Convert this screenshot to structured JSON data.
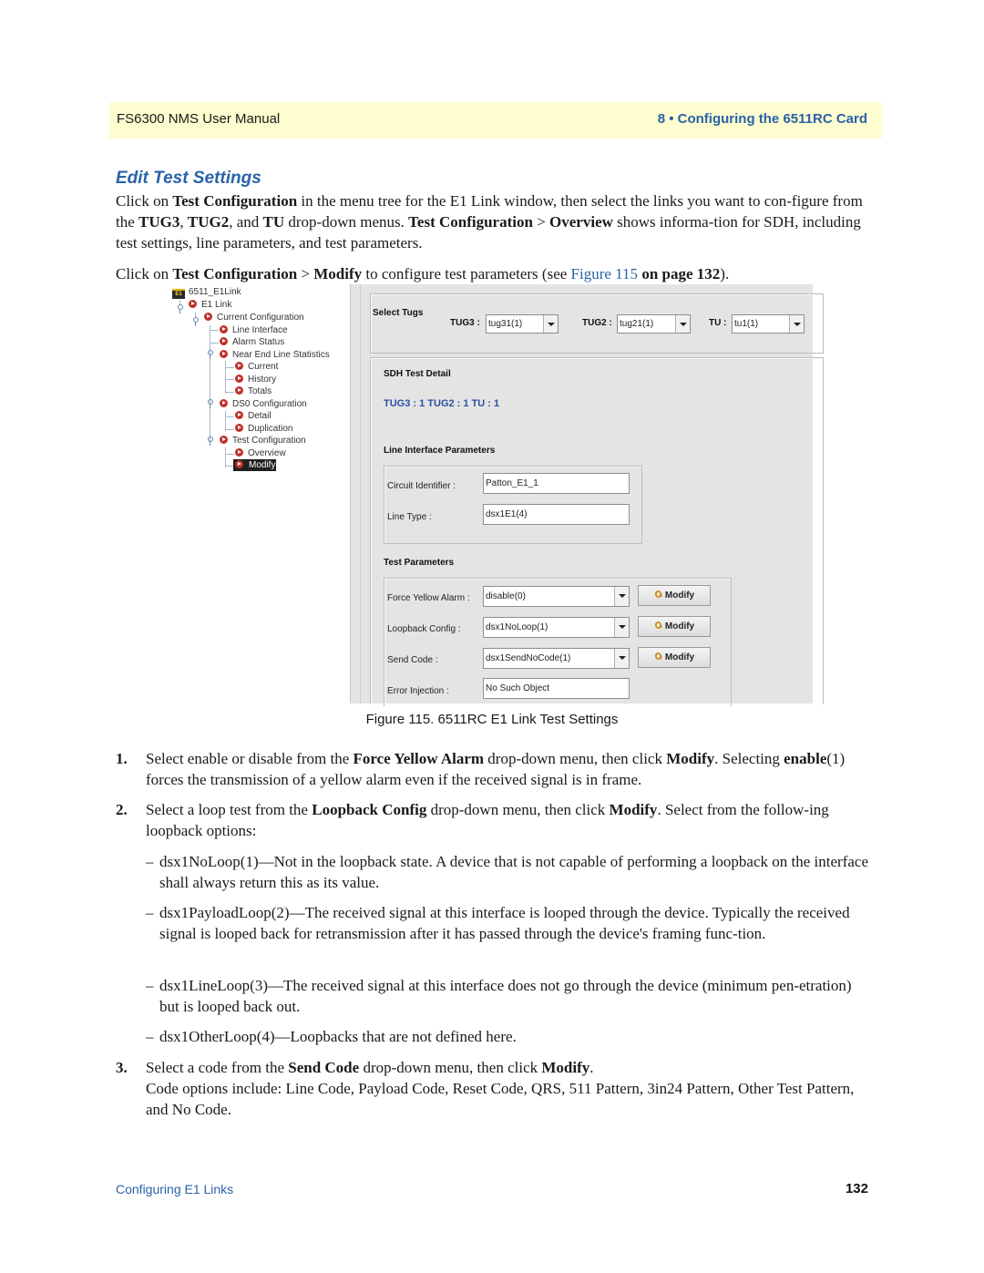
{
  "header": {
    "manual_title": "FS6300 NMS User Manual",
    "chapter": "8 • Configuring the 6511RC Card"
  },
  "section": {
    "title": "Edit Test Settings"
  },
  "intro": {
    "p1": [
      {
        "t": "Click on ",
        "b": false
      },
      {
        "t": "Test Configuration",
        "b": true
      },
      {
        "t": " in the menu tree for the E1 Link window, then select the links you want to con-figure from the ",
        "b": false
      },
      {
        "t": "TUG3",
        "b": true
      },
      {
        "t": ", ",
        "b": false
      },
      {
        "t": "TUG2",
        "b": true
      },
      {
        "t": ", and ",
        "b": false
      },
      {
        "t": "TU",
        "b": true
      },
      {
        "t": " drop-down menus. ",
        "b": false
      },
      {
        "t": "Test Configuration",
        "b": true
      },
      {
        "t": " > ",
        "b": false
      },
      {
        "t": "Overview",
        "b": true
      },
      {
        "t": " shows informa-tion for SDH, including test settings, line parameters, and test parameters.",
        "b": false
      }
    ],
    "p2_prefix": "Click on ",
    "p2_bold1": "Test Configuration",
    "p2_sep": " > ",
    "p2_bold2": "Modify",
    "p2_mid": " to configure test parameters (see ",
    "p2_link": "Figure 115",
    "p2_bold3": " on page 132",
    "p2_end": ")."
  },
  "figure": {
    "caption": "Figure 115. 6511RC E1 Link Test Settings",
    "tree": {
      "root_icon_text": "E1",
      "items": [
        {
          "label": "6511_E1Link",
          "level": 0,
          "icon": "e1-card-icon"
        },
        {
          "label": "E1 Link",
          "level": 1
        },
        {
          "label": "Current Configuration",
          "level": 2
        },
        {
          "label": "Line Interface",
          "level": 3
        },
        {
          "label": "Alarm Status",
          "level": 3
        },
        {
          "label": "Near End Line Statistics",
          "level": 3
        },
        {
          "label": "Current",
          "level": 4
        },
        {
          "label": "History",
          "level": 4
        },
        {
          "label": "Totals",
          "level": 4
        },
        {
          "label": "DS0 Configuration",
          "level": 3
        },
        {
          "label": "Detail",
          "level": 4
        },
        {
          "label": "Duplication",
          "level": 4
        },
        {
          "label": "Test Configuration",
          "level": 3
        },
        {
          "label": "Overview",
          "level": 4
        },
        {
          "label": "Modify",
          "level": 4,
          "selected": true
        }
      ]
    },
    "select_tugs": {
      "title": "Select Tugs",
      "tug3_label": "TUG3 :",
      "tug3_value": "tug31(1)",
      "tug2_label": "TUG2 :",
      "tug2_value": "tug21(1)",
      "tu_label": "TU :",
      "tu_value": "tu1(1)"
    },
    "sdh": {
      "title": "SDH Test Detail",
      "subtitle": "TUG3 : 1 TUG2 : 1 TU : 1",
      "line_params_title": "Line Interface Parameters",
      "circuit_label": "Circuit Identifier :",
      "circuit_value": "Patton_E1_1",
      "line_type_label": "Line Type :",
      "line_type_value": "dsx1E1(4)",
      "test_params_title": "Test Parameters",
      "force_yellow_label": "Force Yellow Alarm :",
      "force_yellow_value": "disable(0)",
      "loopback_label": "Loopback Config :",
      "loopback_value": "dsx1NoLoop(1)",
      "send_code_label": "Send Code :",
      "send_code_value": "dsx1SendNoCode(1)",
      "error_injection_label": "Error Injection :",
      "error_injection_value": "No Such Object",
      "modify_label": "Modify"
    }
  },
  "steps": {
    "s1_num": "1.",
    "s1": [
      {
        "t": "Select enable or disable from the ",
        "b": false
      },
      {
        "t": "Force Yellow Alarm",
        "b": true
      },
      {
        "t": " drop-down menu, then click ",
        "b": false
      },
      {
        "t": "Modify",
        "b": true
      },
      {
        "t": ". Selecting ",
        "b": false
      },
      {
        "t": "enable",
        "b": true
      },
      {
        "t": "(1) forces the transmission of a yellow alarm even if the received signal is in frame.",
        "b": false
      }
    ],
    "s2_num": "2.",
    "s2": [
      {
        "t": "Select a loop test from the ",
        "b": false
      },
      {
        "t": "Loopback Config",
        "b": true
      },
      {
        "t": " drop-down menu, then click ",
        "b": false
      },
      {
        "t": "Modify",
        "b": true
      },
      {
        "t": ". Select from the follow-ing loopback options:",
        "b": false
      }
    ],
    "loopback_options": [
      "dsx1NoLoop(1)—Not in the loopback state. A device that is not capable of performing a loopback on the interface shall always return this as its value.",
      "dsx1PayloadLoop(2)—The received signal at this interface is looped through the device. Typically the received signal is looped back for retransmission after it has passed through the device's framing func-tion.",
      "dsx1LineLoop(3)—The received signal at this interface does not go through the device (minimum pen-etration) but is looped back out.",
      "dsx1OtherLoop(4)—Loopbacks that are not defined here."
    ],
    "dash": "–",
    "s3_num": "3.",
    "s3": [
      {
        "t": "Select a code from the ",
        "b": false
      },
      {
        "t": "Send Code",
        "b": true
      },
      {
        "t": " drop-down menu, then click ",
        "b": false
      },
      {
        "t": "Modify",
        "b": true
      },
      {
        "t": ".",
        "b": false
      }
    ],
    "s3_line2": "Code options include: Line Code, Payload Code, Reset Code, QRS, 511 Pattern, 3in24 Pattern, Other Test Pattern, and No Code."
  },
  "footer": {
    "section": "Configuring E1 Links",
    "page": "132"
  }
}
